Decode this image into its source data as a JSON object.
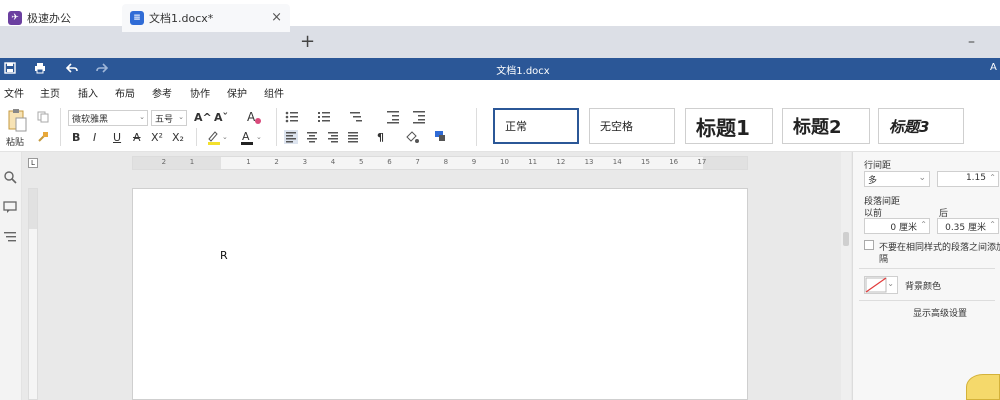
{
  "tabs": [
    {
      "label": "极速办公"
    },
    {
      "label": "文档1.docx*",
      "close": "×"
    }
  ],
  "tab_add": "+",
  "window_min": "–",
  "title": "文档1.docx",
  "title_right": "A",
  "menu": [
    "文件",
    "主页",
    "插入",
    "布局",
    "参考",
    "协作",
    "保护",
    "组件"
  ],
  "ribbon": {
    "paste_label": "粘贴",
    "font_name": "微软雅黑",
    "font_size": "五号",
    "grow_font": "A^",
    "shrink_font": "Aˇ",
    "bold": "B",
    "italic": "I",
    "underline": "U",
    "strike": "A",
    "superscript": "X²",
    "subscript": "X₂",
    "pilcrow": "¶"
  },
  "styles": [
    "正常",
    "无空格",
    "标题1",
    "标题2",
    "标题3"
  ],
  "ruler_labels": [
    "2",
    "1",
    "1",
    "2",
    "3",
    "4",
    "5",
    "6",
    "7",
    "8",
    "9",
    "10",
    "11",
    "12",
    "13",
    "14",
    "15",
    "16",
    "17"
  ],
  "ruler_corner": "L",
  "document_text": "R",
  "panel": {
    "line_spacing_label": "行间距",
    "line_spacing_mode": "多",
    "line_spacing_value": "1.15",
    "para_spacing_label": "段落间距",
    "before_label": "以前",
    "after_label": "后",
    "before_value": "0 厘米",
    "after_value": "0.35 厘米",
    "no_space_checkbox_line1": "不要在相同样式的段落之间添加",
    "no_space_checkbox_line2": "隔",
    "bg_color_label": "背景颜色",
    "advanced_link": "显示高级设置"
  },
  "colors": {
    "title_bar": "#2b5797",
    "tab_icon_app": "#6b3fa0",
    "tab_icon_doc": "#2f6bd6"
  }
}
